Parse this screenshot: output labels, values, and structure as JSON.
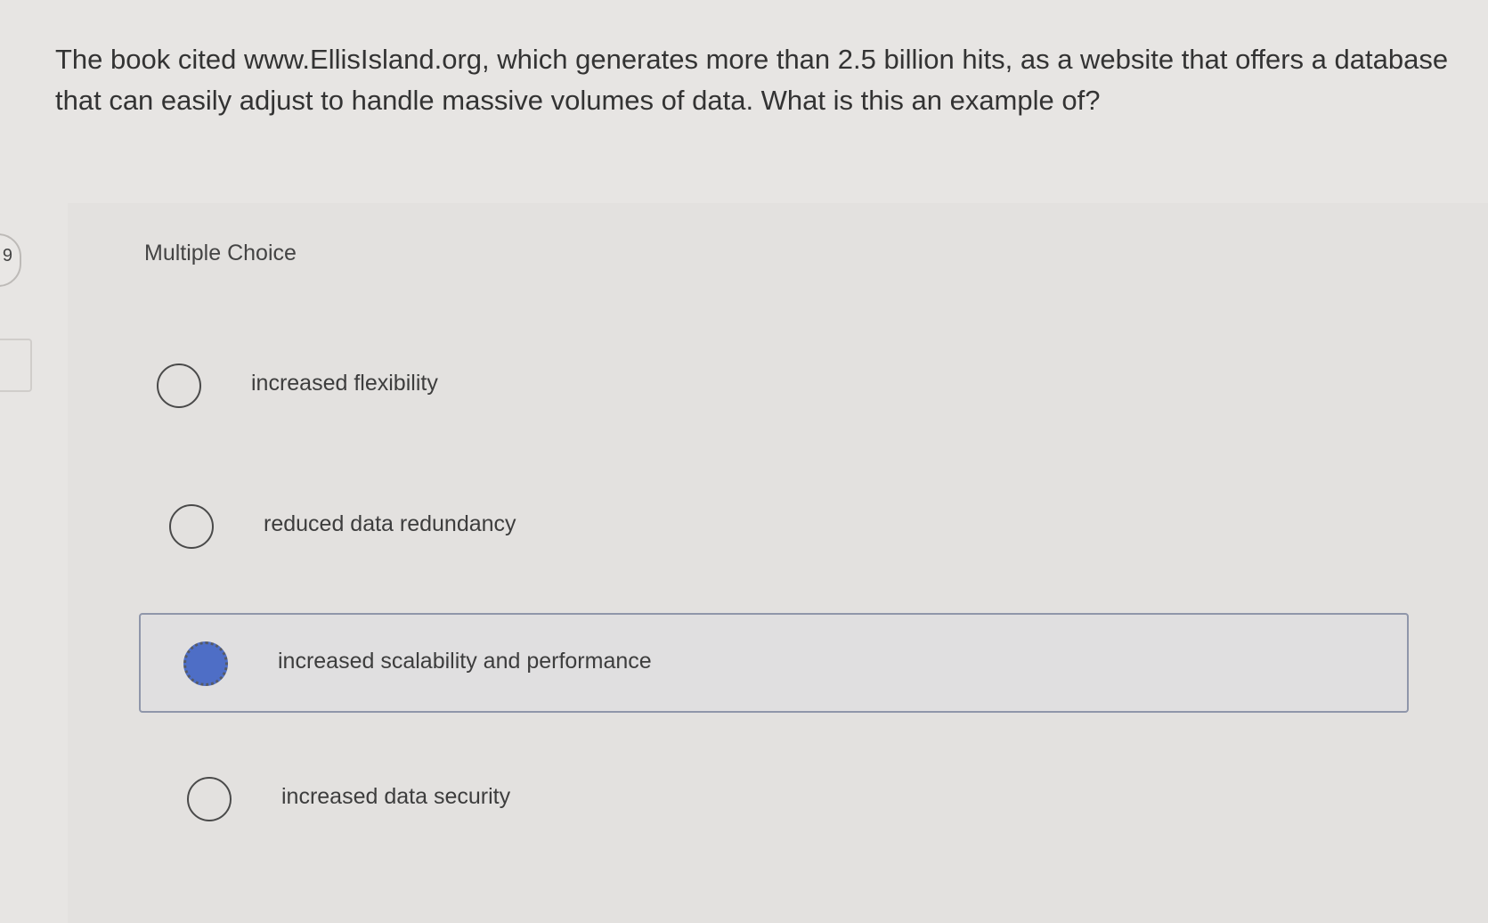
{
  "question": {
    "text": "The book cited www.EllisIsland.org, which generates more than 2.5 billion hits, as a website that offers a database that can easily adjust to handle massive volumes of data. What is this an example of?"
  },
  "side_tab": {
    "glyph": "9"
  },
  "answer_panel": {
    "type_label": "Multiple Choice",
    "options": [
      {
        "label": "increased flexibility",
        "selected": false
      },
      {
        "label": "reduced data redundancy",
        "selected": false
      },
      {
        "label": "increased scalability and performance",
        "selected": true
      },
      {
        "label": "increased data security",
        "selected": false
      }
    ]
  },
  "colors": {
    "background": "#e7e5e3",
    "panel": "#e3e1df",
    "selected_fill": "#4e6ec6",
    "selected_border": "#8f96aa"
  }
}
